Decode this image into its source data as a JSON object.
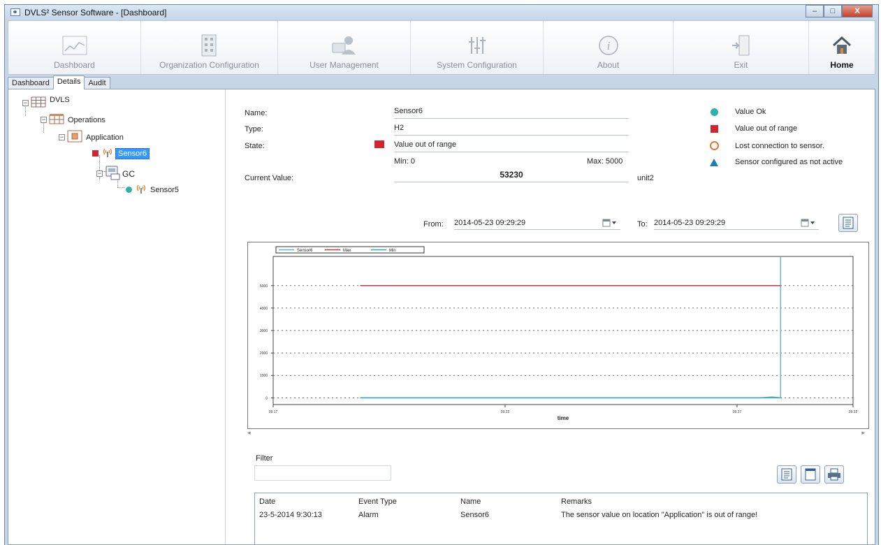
{
  "window": {
    "title": "DVLS² Sensor Software - [Dashboard]",
    "controls": {
      "minimize": "–",
      "maximize": "□",
      "close": "X"
    }
  },
  "toolbar": {
    "items": [
      {
        "label": "Dashboard",
        "icon": "chart-icon"
      },
      {
        "label": "Organization Configuration",
        "icon": "building-icon"
      },
      {
        "label": "User Management",
        "icon": "users-icon"
      },
      {
        "label": "System Configuration",
        "icon": "sliders-icon"
      },
      {
        "label": "About",
        "icon": "info-icon"
      },
      {
        "label": "Exit",
        "icon": "exit-door-icon"
      },
      {
        "label": "Home",
        "icon": "home-icon"
      }
    ]
  },
  "tabs": [
    {
      "label": "Dashboard",
      "active": false
    },
    {
      "label": "Details",
      "active": true
    },
    {
      "label": "Audit",
      "active": false
    }
  ],
  "tree": {
    "root": "DVLS",
    "operations": "Operations",
    "application": "Application",
    "sensor6": "Sensor6",
    "gc": "GC",
    "sensor5": "Sensor5",
    "expander_symbol": "−"
  },
  "details": {
    "name_label": "Name:",
    "name_value": "Sensor6",
    "type_label": "Type:",
    "type_value": "H2",
    "state_label": "State:",
    "state_value": "Value out of range",
    "min_label": "Min: 0",
    "max_label": "Max: 5000",
    "current_value_label": "Current Value:",
    "current_value": "53230",
    "unit": "unit2"
  },
  "legend": [
    {
      "label": "Value Ok",
      "shape": "circle",
      "color": "#2bb3a8"
    },
    {
      "label": "Value out of range",
      "shape": "square",
      "color": "#d0262f"
    },
    {
      "label": "Lost connection to sensor.",
      "shape": "ring",
      "color": "#e0782c"
    },
    {
      "label": "Sensor configured as not active",
      "shape": "triangle",
      "color": "#1e7cb5"
    }
  ],
  "range": {
    "from_label": "From:",
    "from_value": "2014-05-23 09:29:29",
    "to_label": "To:",
    "to_value": "2014-05-23 09:29:29"
  },
  "chart_data": {
    "type": "line",
    "xlabel": "time",
    "ylabel": "",
    "ylim": [
      -300,
      6300
    ],
    "yticks": [
      0,
      1000,
      2000,
      3000,
      4000,
      5000
    ],
    "ytick_labels": [
      "0",
      "1000",
      "2000",
      "3000",
      "4000",
      "5000"
    ],
    "xticks": [
      0,
      0.4,
      0.8,
      1
    ],
    "xtick_labels": [
      "09.17",
      "09.22",
      "09.27",
      "09.32"
    ],
    "grid": true,
    "legend_position": "top-left",
    "series": [
      {
        "name": "Sensor6",
        "color": "#5fb3d4",
        "x": [
          0.15,
          0.84,
          0.86,
          0.875,
          0.875
        ],
        "y": [
          0,
          0,
          40,
          0,
          6300
        ]
      },
      {
        "name": "Max",
        "color": "#c0394b",
        "x": [
          0.15,
          0.875
        ],
        "y": [
          5000,
          5000
        ]
      },
      {
        "name": "Min",
        "color": "#3aa3b8",
        "x": [
          0.15,
          0.875
        ],
        "y": [
          0,
          0
        ]
      }
    ]
  },
  "scroll": {
    "left": "◂",
    "right": "▸"
  },
  "events": {
    "filter_label": "Filter",
    "columns": [
      "Date",
      "Event Type",
      "Name",
      "Remarks"
    ],
    "rows": [
      [
        "23-5-2014 9:30:13",
        "Alarm",
        "Sensor6",
        "The sensor value on location \"Application\" is out of range!"
      ]
    ]
  }
}
